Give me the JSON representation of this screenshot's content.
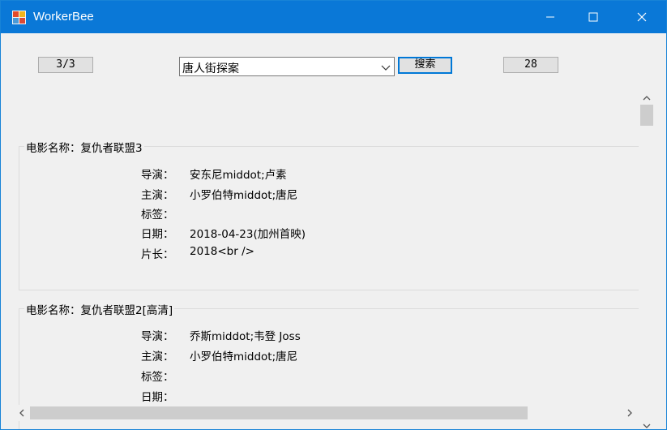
{
  "window": {
    "title": "WorkerBee"
  },
  "toolbar": {
    "page_indicator": "3/3",
    "search_query": "唐人街探案",
    "search_button": "搜索",
    "result_count": "28"
  },
  "movies": [
    {
      "title": "电影名称：复仇者联盟3",
      "fields": [
        {
          "label": "导演：",
          "value": "安东尼middot;卢素"
        },
        {
          "label": "主演：",
          "value": "小罗伯特middot;唐尼"
        },
        {
          "label": "标签：",
          "value": ""
        },
        {
          "label": "日期：",
          "value": "2018-04-23(加州首映)"
        },
        {
          "label": "片长：",
          "value": "2018<br />"
        }
      ]
    },
    {
      "title": "电影名称：复仇者联盟2[高清]",
      "fields": [
        {
          "label": "导演：",
          "value": "乔斯middot;韦登 Joss"
        },
        {
          "label": "主演：",
          "value": "小罗伯特middot;唐尼"
        },
        {
          "label": "标签：",
          "value": ""
        },
        {
          "label": "日期：",
          "value": ""
        }
      ]
    }
  ],
  "colors": {
    "titlebar": "#0a78d7",
    "window_bg": "#f0f0f0",
    "accent": "#0078d7"
  }
}
